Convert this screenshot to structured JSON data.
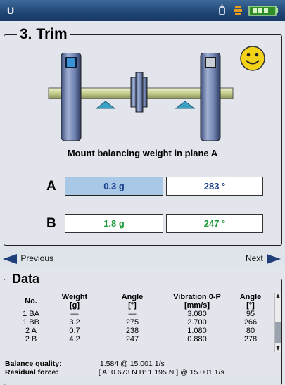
{
  "title": "U",
  "section": {
    "title": "3. Trim"
  },
  "instruction": "Mount balancing weight in plane A",
  "plane_a": {
    "label": "A",
    "weight": "0.3 g",
    "angle": "283 °"
  },
  "plane_b": {
    "label": "B",
    "weight": "1.8 g",
    "angle": "247 °"
  },
  "nav": {
    "previous": "Previous",
    "next": "Next"
  },
  "data_section": {
    "title": "Data",
    "headers": {
      "no": "No.",
      "weight": [
        "Weight",
        "[g]"
      ],
      "angle": [
        "Angle",
        "[°]"
      ],
      "vibration": [
        "Vibration 0-P",
        "[mm/s]"
      ],
      "angle2": [
        "Angle",
        "[°]"
      ]
    },
    "rows": [
      {
        "no": "1 BA",
        "weight": "—",
        "angle": "—",
        "vibration": "3.080",
        "angle2": "95"
      },
      {
        "no": "1 BB",
        "weight": "3.2",
        "angle": "275",
        "vibration": "2.700",
        "angle2": "266"
      },
      {
        "no": "2 A",
        "weight": "0.7",
        "angle": "238",
        "vibration": "1.080",
        "angle2": "80"
      },
      {
        "no": "2 B",
        "weight": "4.2",
        "angle": "247",
        "vibration": "0.880",
        "angle2": "278"
      }
    ],
    "balance_quality": {
      "label": "Balance quality:",
      "value": "1.584 @ 15.001 1/s"
    },
    "residual_force": {
      "label": "Residual force:",
      "value": "[ A: 0.673 N    B: 1.195 N ] @ 15.001 1/s"
    }
  },
  "colors": {
    "accent": "#1f4674",
    "plane_a_box": "#a9c8e6",
    "weight_text_a": "#1a3f8f",
    "weight_text_b": "#1d9a3a",
    "angle_text_a": "#1a3f8f",
    "angle_text_b": "#1d9a3a",
    "smiley": "#f3d21a"
  },
  "icons": [
    "sensor-icon",
    "connection-icon",
    "battery-icon",
    "smiley-icon",
    "arrow-left-icon",
    "arrow-right-icon"
  ]
}
